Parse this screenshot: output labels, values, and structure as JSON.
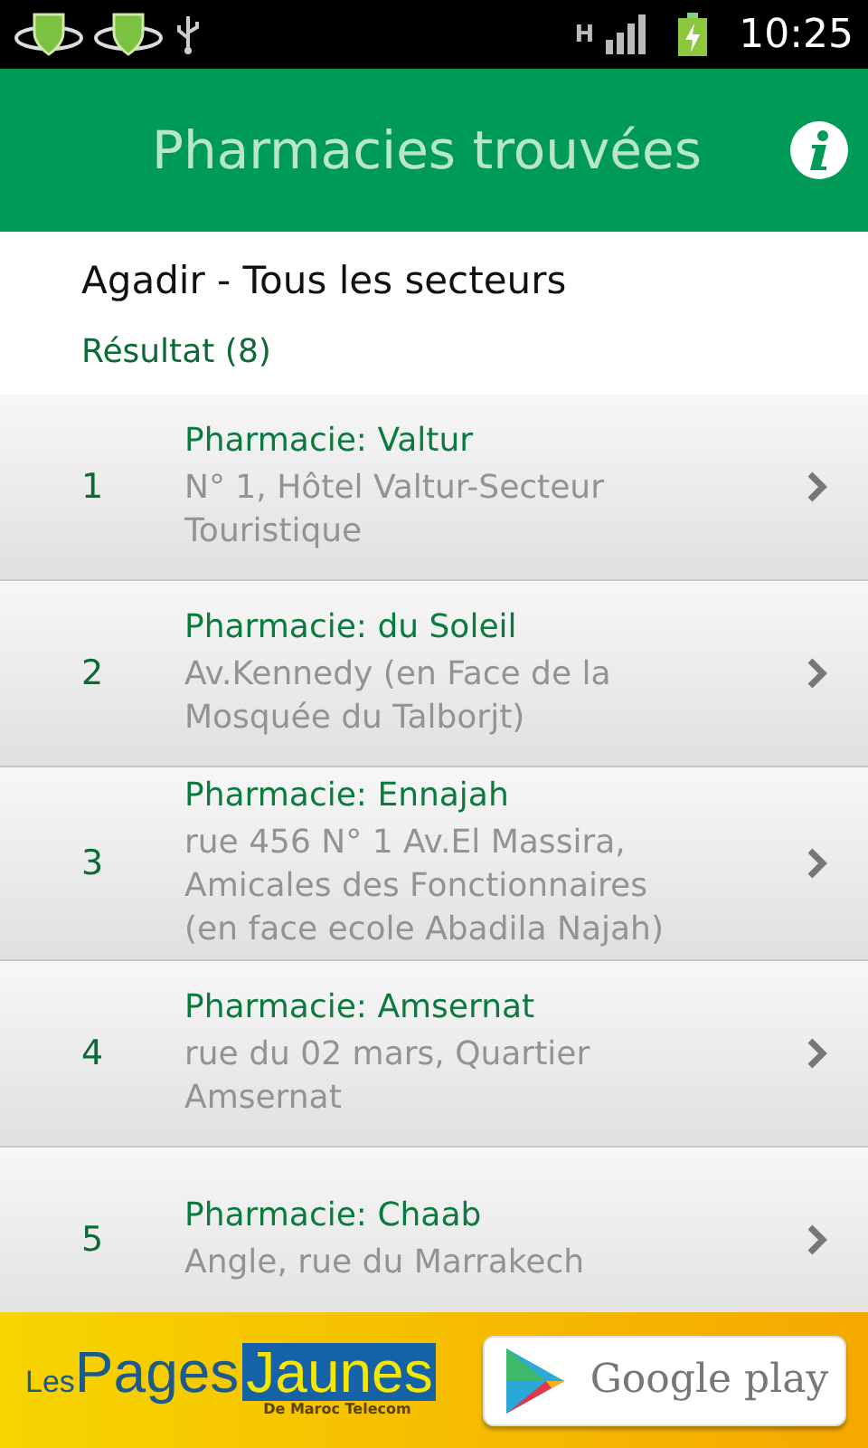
{
  "status_bar": {
    "network": "H",
    "time": "10:25"
  },
  "header": {
    "title": "Pharmacies trouvées"
  },
  "search": {
    "location": "Agadir - Tous les secteurs",
    "result": "Résultat (8)"
  },
  "pharmacies": [
    {
      "number": "1",
      "name": "Pharmacie: Valtur",
      "address": "N° 1, Hôtel Valtur-Secteur Touristique"
    },
    {
      "number": "2",
      "name": "Pharmacie: du Soleil",
      "address": "Av.Kennedy (en Face de la Mosquée du Talborjt)"
    },
    {
      "number": "3",
      "name": "Pharmacie: Ennajah",
      "address": "rue 456 N° 1 Av.El Massira, Amicales des Fonctionnaires (en face ecole Abadila Najah)"
    },
    {
      "number": "4",
      "name": "Pharmacie: Amsernat",
      "address": "rue du 02 mars, Quartier Amsernat"
    },
    {
      "number": "5",
      "name": "Pharmacie: Chaab",
      "address": "Angle, rue du Marrakech"
    }
  ],
  "banner": {
    "logo_prefix": "Les",
    "logo_main": "Pages",
    "logo_highlight": "Jaunes",
    "logo_sub": "De Maroc Telecom",
    "store_button": "Google play"
  }
}
